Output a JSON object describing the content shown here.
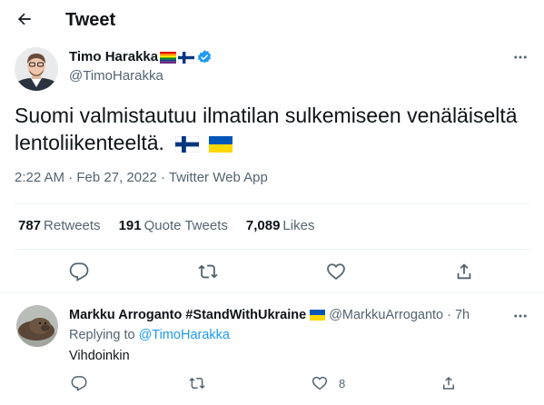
{
  "header": {
    "title": "Tweet"
  },
  "tweet": {
    "author_name": "Timo Harakka",
    "author_handle": "@TimoHarakka",
    "text": "Suomi valmistautuu ilmatilan sulkemiseen venäläiseltä lentoliikenteeltä.",
    "time": "2:22 AM",
    "date": "Feb 27, 2022",
    "source": "Twitter Web App",
    "meta_separator": "·",
    "stats": {
      "retweets_count": "787",
      "retweets_label": "Retweets",
      "quotes_count": "191",
      "quotes_label": "Quote Tweets",
      "likes_count": "7,089",
      "likes_label": "Likes"
    }
  },
  "reply": {
    "author_name": "Markku Arroganto #StandWithUkraine",
    "author_handle": "@MarkkuArroganto",
    "time_sep": "·",
    "time": "7h",
    "replying_prefix": "Replying to",
    "replying_to": "@TimoHarakka",
    "text": "Vihdoinkin",
    "like_count": "8"
  },
  "colors": {
    "accent": "#1d9bf0",
    "text_primary": "#0f1419",
    "text_secondary": "#536471",
    "divider": "#eff3f4"
  }
}
